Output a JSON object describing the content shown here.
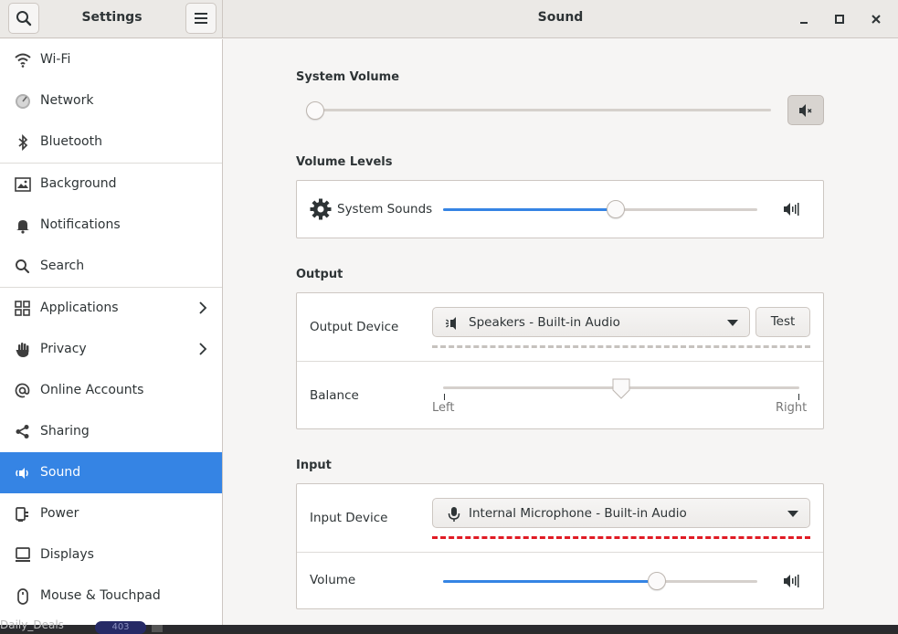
{
  "window": {
    "sidebar_title": "Settings",
    "main_title": "Sound"
  },
  "sidebar": {
    "items": [
      {
        "label": "Wi-Fi",
        "icon": "wifi-icon"
      },
      {
        "label": "Network",
        "icon": "network-icon"
      },
      {
        "label": "Bluetooth",
        "icon": "bluetooth-icon"
      },
      {
        "label": "Background",
        "icon": "background-icon"
      },
      {
        "label": "Notifications",
        "icon": "bell-icon"
      },
      {
        "label": "Search",
        "icon": "search-icon"
      },
      {
        "label": "Applications",
        "icon": "grid-icon",
        "chevron": true
      },
      {
        "label": "Privacy",
        "icon": "hand-icon",
        "chevron": true
      },
      {
        "label": "Online Accounts",
        "icon": "at-icon"
      },
      {
        "label": "Sharing",
        "icon": "share-icon"
      },
      {
        "label": "Sound",
        "icon": "speaker-icon",
        "active": true
      },
      {
        "label": "Power",
        "icon": "plug-icon"
      },
      {
        "label": "Displays",
        "icon": "display-icon"
      },
      {
        "label": "Mouse & Touchpad",
        "icon": "mouse-icon"
      }
    ]
  },
  "system_volume": {
    "heading": "System Volume",
    "value": 0,
    "muted": true
  },
  "volume_levels": {
    "heading": "Volume Levels",
    "system_sounds_label": "System Sounds",
    "system_sounds_value": 0.55
  },
  "output": {
    "heading": "Output",
    "device_label": "Output Device",
    "device_value": "Speakers - Built-in Audio",
    "test_label": "Test",
    "balance_label": "Balance",
    "balance_value": 0.5,
    "left_label": "Left",
    "right_label": "Right"
  },
  "input": {
    "heading": "Input",
    "device_label": "Input Device",
    "device_value": "Internal Microphone - Built-in Audio",
    "volume_label": "Volume",
    "volume_value": 0.68
  },
  "background_app": {
    "text": "Daily_Deals",
    "count": "403"
  },
  "colors": {
    "accent": "#3584e4",
    "input_level": "#e01b24"
  }
}
